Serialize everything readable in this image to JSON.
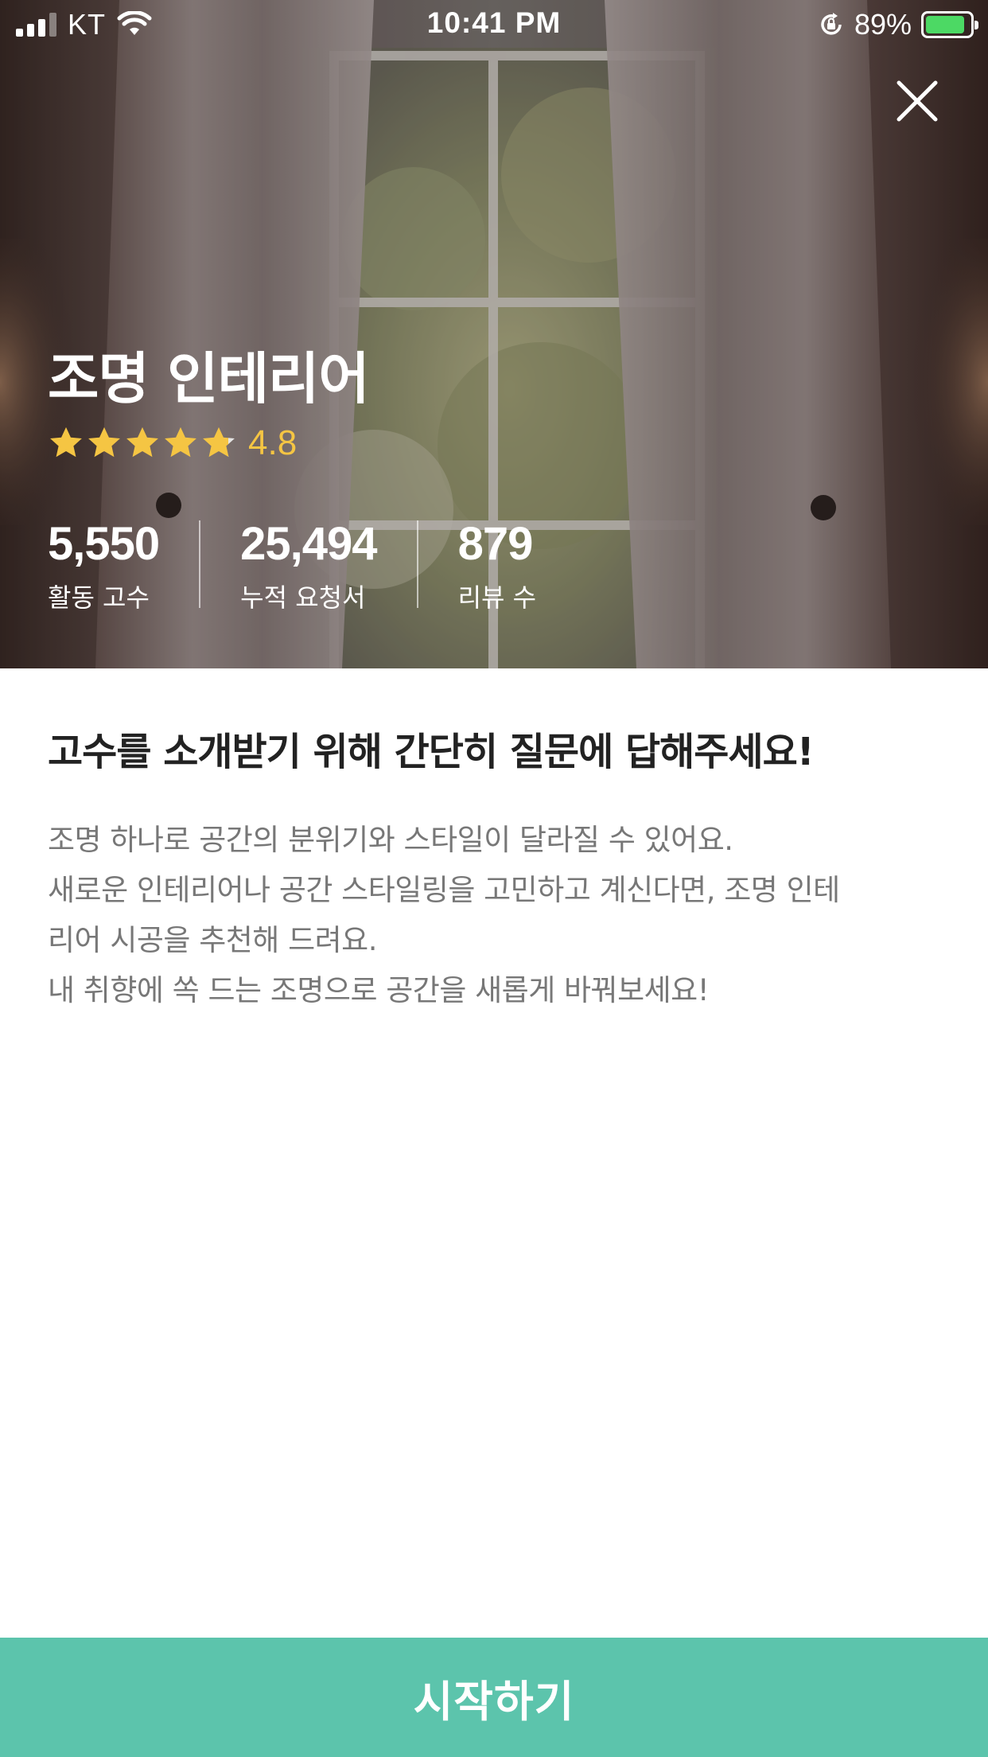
{
  "status_bar": {
    "carrier": "KT",
    "time": "10:41 PM",
    "battery_percent": "89%",
    "battery_level": 0.89,
    "icons": [
      "signal-icon",
      "wifi-icon",
      "rotation-lock-icon",
      "battery-charging-icon"
    ]
  },
  "hero": {
    "title": "조명 인테리어",
    "rating_value": "4.8",
    "rating": 4.8,
    "rating_max": 5,
    "star_color": "#f5c543",
    "stats": [
      {
        "value": "5,550",
        "label": "활동 고수"
      },
      {
        "value": "25,494",
        "label": "누적 요청서"
      },
      {
        "value": "879",
        "label": "리뷰 수"
      }
    ],
    "close_icon": "close-icon"
  },
  "content": {
    "headline": "고수를 소개받기 위해 간단히 질문에 답해주세요!",
    "description_lines": [
      "조명 하나로 공간의 분위기와 스타일이 달라질 수 있어요.",
      "새로운 인테리어나 공간 스타일링을 고민하고 계신다면, 조명 인테",
      "리어 시공을 추천해 드려요.",
      "내 취향에 쏙 드는 조명으로 공간을 새롭게 바꿔보세요!"
    ]
  },
  "cta": {
    "label": "시작하기",
    "color": "#5cc4ac"
  }
}
